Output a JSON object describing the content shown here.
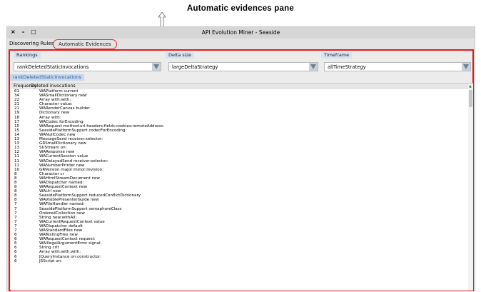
{
  "annotation": "Automatic evidences pane",
  "window": {
    "controls": "× – □",
    "title": "API Evolution Miner - Seaside"
  },
  "tabs": {
    "discovering": "Discovering Rules",
    "automatic": "Automatic Evidences"
  },
  "filters": {
    "rankings": {
      "label": "Rankings",
      "value": "rankDeletedStaticInvocations"
    },
    "delta": {
      "label": "Delta size",
      "value": "largeDeltaStrategy"
    },
    "timeframe": {
      "label": "Timeframe",
      "value": "allTimeStrategy"
    }
  },
  "result_tab": "rankDeletedStaticInvocations",
  "table": {
    "headers": {
      "frequency": "Frequency",
      "name": "Deleted invocations"
    },
    "rows": [
      {
        "f": "61",
        "n": "WAPlatform current"
      },
      {
        "f": "34",
        "n": "WASmallDictionary new"
      },
      {
        "f": "22",
        "n": "Array with:with:"
      },
      {
        "f": "21",
        "n": "Character value:"
      },
      {
        "f": "21",
        "n": "WARenderCanvas builder"
      },
      {
        "f": "19",
        "n": "Dictionary new"
      },
      {
        "f": "18",
        "n": "Array with:"
      },
      {
        "f": "17",
        "n": "WACodec forEncoding:"
      },
      {
        "f": "15",
        "n": "WARequest method:url:headers:fields:cookies:remoteAddress:"
      },
      {
        "f": "15",
        "n": "SeasidePlatformSupport codecForEncoding:"
      },
      {
        "f": "14",
        "n": "WANullCodec new"
      },
      {
        "f": "13",
        "n": "MessageSend receiver:selector:"
      },
      {
        "f": "13",
        "n": "GRSmallDictionary new"
      },
      {
        "f": "13",
        "n": "SUStream on:"
      },
      {
        "f": "12",
        "n": "WAResponse new"
      },
      {
        "f": "11",
        "n": "WACurrentSession value"
      },
      {
        "f": "11",
        "n": "WADelayedSend receiver:selector:"
      },
      {
        "f": "11",
        "n": "WANumberPrinter new"
      },
      {
        "f": "10",
        "n": "GRVersion major:minor:revision:"
      },
      {
        "f": "8",
        "n": "Character cr"
      },
      {
        "f": "8",
        "n": "WAHtmlStreamDocument new"
      },
      {
        "f": "8",
        "n": "WADispatcher named:"
      },
      {
        "f": "8",
        "n": "WARequestContext new"
      },
      {
        "f": "8",
        "n": "WAUrl new"
      },
      {
        "f": "8",
        "n": "SeasidePlatformSupport reducedConflictDictionary"
      },
      {
        "f": "8",
        "n": "WAVisiblePresenterGuide new"
      },
      {
        "f": "7",
        "n": "WAFileHandler named:"
      },
      {
        "f": "7",
        "n": "SeasidePlatformSupport semaphoreClass"
      },
      {
        "f": "7",
        "n": "OrderedCollection new"
      },
      {
        "f": "7",
        "n": "String new:withAll:"
      },
      {
        "f": "7",
        "n": "WACurrentRequestContext value"
      },
      {
        "f": "7",
        "n": "WADispatcher default"
      },
      {
        "f": "7",
        "n": "WAStandardFiles new"
      },
      {
        "f": "6",
        "n": "WATestingFiles new"
      },
      {
        "f": "6",
        "n": "WARequestContext request:"
      },
      {
        "f": "6",
        "n": "WAIllegalArgumentError signal:"
      },
      {
        "f": "6",
        "n": "String crlf"
      },
      {
        "f": "6",
        "n": "Array with:with:with:"
      },
      {
        "f": "6",
        "n": "JQueryInstance on:constructor:"
      },
      {
        "f": "6",
        "n": "JSScript on:"
      }
    ]
  }
}
